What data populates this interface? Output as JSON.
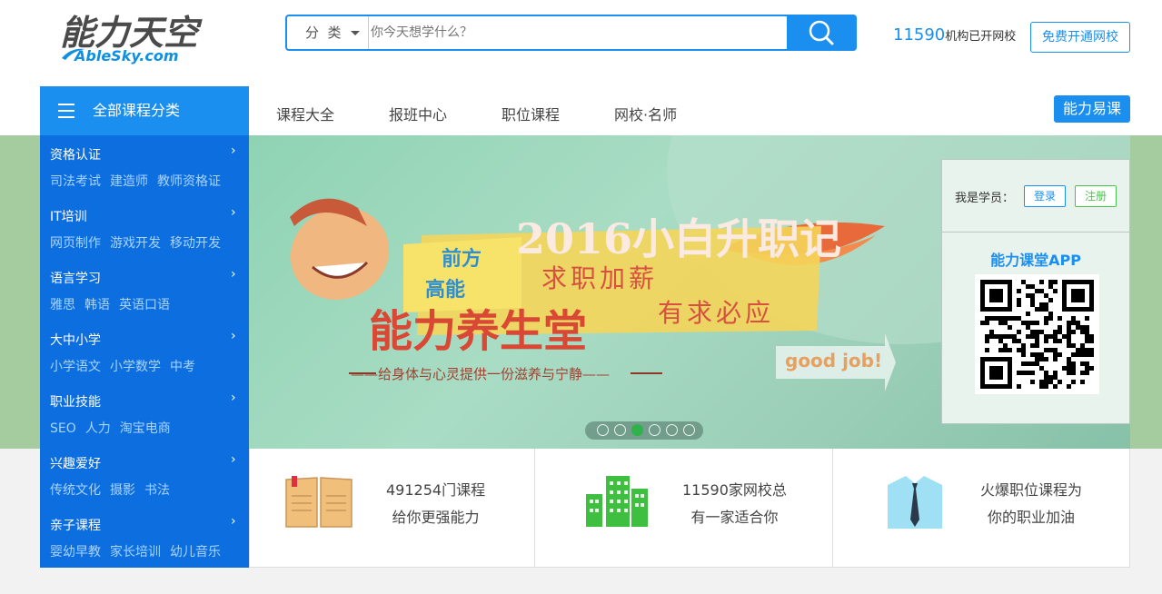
{
  "logo": {
    "main": "能力天空",
    "sub": "AbleSky.com"
  },
  "search": {
    "category_label": "分  类",
    "placeholder": "你今天想学什么？"
  },
  "header_stat": {
    "count": "11590",
    "suffix": "机构已开网校"
  },
  "open_school_label": "免费开通网校",
  "category_bar_label": "全部课程分类",
  "nav": [
    "课程大全",
    "报班中心",
    "职位课程",
    "网校·名师"
  ],
  "easy_course_label": "能力易课",
  "sidebar": [
    {
      "title": "资格认证",
      "links": [
        "司法考试",
        "建造师",
        "教师资格证"
      ]
    },
    {
      "title": "IT培训",
      "links": [
        "网页制作",
        "游戏开发",
        "移动开发"
      ]
    },
    {
      "title": "语言学习",
      "links": [
        "雅思",
        "韩语",
        "英语口语"
      ]
    },
    {
      "title": "大中小学",
      "links": [
        "小学语文",
        "小学数学",
        "中考"
      ]
    },
    {
      "title": "职业技能",
      "links": [
        "SEO",
        "人力",
        "淘宝电商"
      ]
    },
    {
      "title": "兴趣爱好",
      "links": [
        "传统文化",
        "摄影",
        "书法"
      ]
    },
    {
      "title": "亲子课程",
      "links": [
        "婴幼早教",
        "家长培训",
        "幼儿音乐"
      ]
    }
  ],
  "banner": {
    "headline": "2016小白升职记",
    "tag1": "前方",
    "tag2": "高能",
    "slogan": "求职加薪",
    "slogan2": "有求必应",
    "title": "能力养生堂",
    "subtitle": "——给身体与心灵提供一份滋养与宁静——",
    "good_job": "good job!",
    "active_slide": 3,
    "slide_count": 6
  },
  "panel": {
    "label": "我是学员：",
    "login": "登录",
    "register": "注册",
    "app_title": "能力课堂APP"
  },
  "features": [
    {
      "line1": "491254门课程",
      "line2": "给你更强能力",
      "icon": "book-icon"
    },
    {
      "line1": "11590家网校总",
      "line2": "有一家适合你",
      "icon": "buildings-icon"
    },
    {
      "line1": "火爆职位课程为",
      "line2": "你的职业加油",
      "icon": "shirt-tie-icon"
    }
  ],
  "colors": {
    "brand_blue": "#1a8ff0",
    "sidebar_blue": "#0d6ee0",
    "green": "#49c44a"
  }
}
